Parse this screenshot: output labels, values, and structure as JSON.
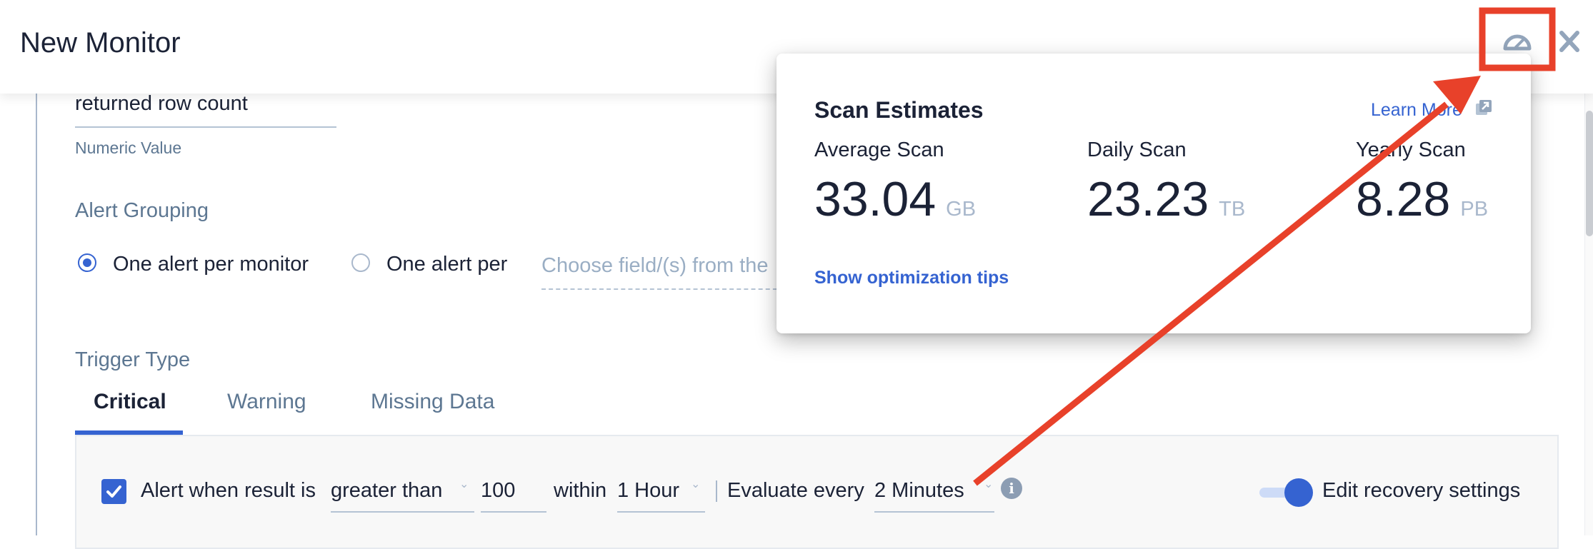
{
  "header": {
    "title": "New Monitor",
    "gauge_icon": "gauge-icon",
    "close_icon": "close-icon"
  },
  "query_field": {
    "value": "returned row count",
    "label": "Numeric Value"
  },
  "alert_grouping": {
    "label": "Alert Grouping",
    "options": [
      {
        "label": "One alert per monitor",
        "selected": true
      },
      {
        "label": "One alert per",
        "selected": false
      }
    ],
    "field_placeholder": "Choose field/(s) from the"
  },
  "trigger_type": {
    "label": "Trigger Type",
    "tabs": [
      {
        "label": "Critical",
        "active": true
      },
      {
        "label": "Warning",
        "active": false
      },
      {
        "label": "Missing Data",
        "active": false
      }
    ],
    "critical": {
      "enabled": true,
      "prefix": "Alert when result is",
      "condition": "greater than",
      "threshold": "100",
      "within_label": "within",
      "window": "1 Hour",
      "evaluate_label": "Evaluate every",
      "evaluate_interval": "2 Minutes",
      "info_icon": "info-icon",
      "recovery_toggle_on": true,
      "recovery_label": "Edit recovery settings"
    }
  },
  "scan_estimates": {
    "title": "Scan Estimates",
    "learn_more": "Learn More",
    "metrics": [
      {
        "label": "Average Scan",
        "value": "33.04",
        "unit": "GB"
      },
      {
        "label": "Daily Scan",
        "value": "23.23",
        "unit": "TB"
      },
      {
        "label": "Yearly Scan",
        "value": "8.28",
        "unit": "PB"
      }
    ],
    "optimization_link": "Show optimization tips"
  },
  "annotation": {
    "color": "#e8412a",
    "type": "arrow-to-highlighted-gauge-button"
  },
  "colors": {
    "accent": "#3563d1",
    "text": "#1b2236",
    "muted": "#5d7792",
    "placeholder": "#9aaec4"
  }
}
